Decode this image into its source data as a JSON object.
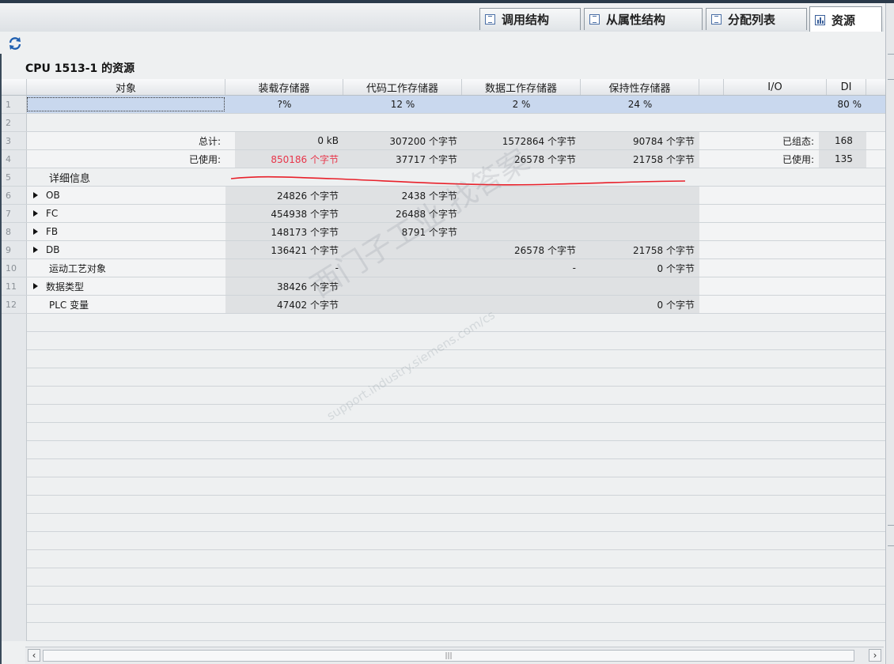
{
  "tabs": [
    {
      "label": "调用结构",
      "icon": "call-structure-icon"
    },
    {
      "label": "从属性结构",
      "icon": "dependency-structure-icon"
    },
    {
      "label": "分配列表",
      "icon": "assignment-list-icon"
    },
    {
      "label": "资源",
      "icon": "resources-chart-icon",
      "active": true
    }
  ],
  "toolbar": {
    "refresh_icon": "refresh-icon"
  },
  "title": "CPU 1513-1 的资源",
  "columns": [
    "对象",
    "装载存储器",
    "代码工作存储器",
    "数据工作存储器",
    "保持性存储器",
    "I/O",
    "DI"
  ],
  "rows": [
    {
      "num": "1",
      "object": "",
      "load": "?%",
      "code": "12 %",
      "data": "2 %",
      "retain": "24 %",
      "io": "",
      "di": "80 %"
    },
    {
      "num": "2",
      "object": "",
      "load": "",
      "code": "",
      "data": "",
      "retain": "",
      "io": "",
      "di": ""
    },
    {
      "num": "3",
      "object": "总计:",
      "load": "0 kB",
      "code": "307200 个字节",
      "data": "1572864 个字节",
      "retain": "90784 个字节",
      "io": "已组态:",
      "di": "168"
    },
    {
      "num": "4",
      "object": "已使用:",
      "load": "850186 个字节",
      "code": "37717 个字节",
      "data": "26578 个字节",
      "retain": "21758 个字节",
      "io": "已使用:",
      "di": "135"
    },
    {
      "num": "5",
      "object": "详细信息",
      "load": "",
      "code": "",
      "data": "",
      "retain": "",
      "io": "",
      "di": ""
    },
    {
      "num": "6",
      "object": "OB",
      "load": "24826 个字节",
      "code": "2438 个字节",
      "data": "",
      "retain": "",
      "io": "",
      "di": ""
    },
    {
      "num": "7",
      "object": "FC",
      "load": "454938 个字节",
      "code": "26488 个字节",
      "data": "",
      "retain": "",
      "io": "",
      "di": ""
    },
    {
      "num": "8",
      "object": "FB",
      "load": "148173 个字节",
      "code": "8791 个字节",
      "data": "",
      "retain": "",
      "io": "",
      "di": ""
    },
    {
      "num": "9",
      "object": "DB",
      "load": "136421 个字节",
      "code": "",
      "data": "26578 个字节",
      "retain": "21758 个字节",
      "io": "",
      "di": ""
    },
    {
      "num": "10",
      "object": "运动工艺对象",
      "load": "-",
      "code": "",
      "data": "-",
      "retain": "0 个字节",
      "io": "",
      "di": ""
    },
    {
      "num": "11",
      "object": "数据类型",
      "load": "38426 个字节",
      "code": "",
      "data": "",
      "retain": "",
      "io": "",
      "di": ""
    },
    {
      "num": "12",
      "object": "PLC 变量",
      "load": "47402 个字节",
      "code": "",
      "data": "",
      "retain": "0 个字节",
      "io": "",
      "di": ""
    }
  ],
  "watermark": {
    "main": "西门子工业  找答案",
    "sub": "support.industry.siemens.com/cs"
  },
  "scrollbar": {
    "left_arrow": "‹",
    "right_arrow": "›",
    "grip": "|||"
  },
  "colors": {
    "highlight_red": "#e8354a",
    "selected_row": "#c9d8ee",
    "annotation_line": "#e8202a"
  }
}
